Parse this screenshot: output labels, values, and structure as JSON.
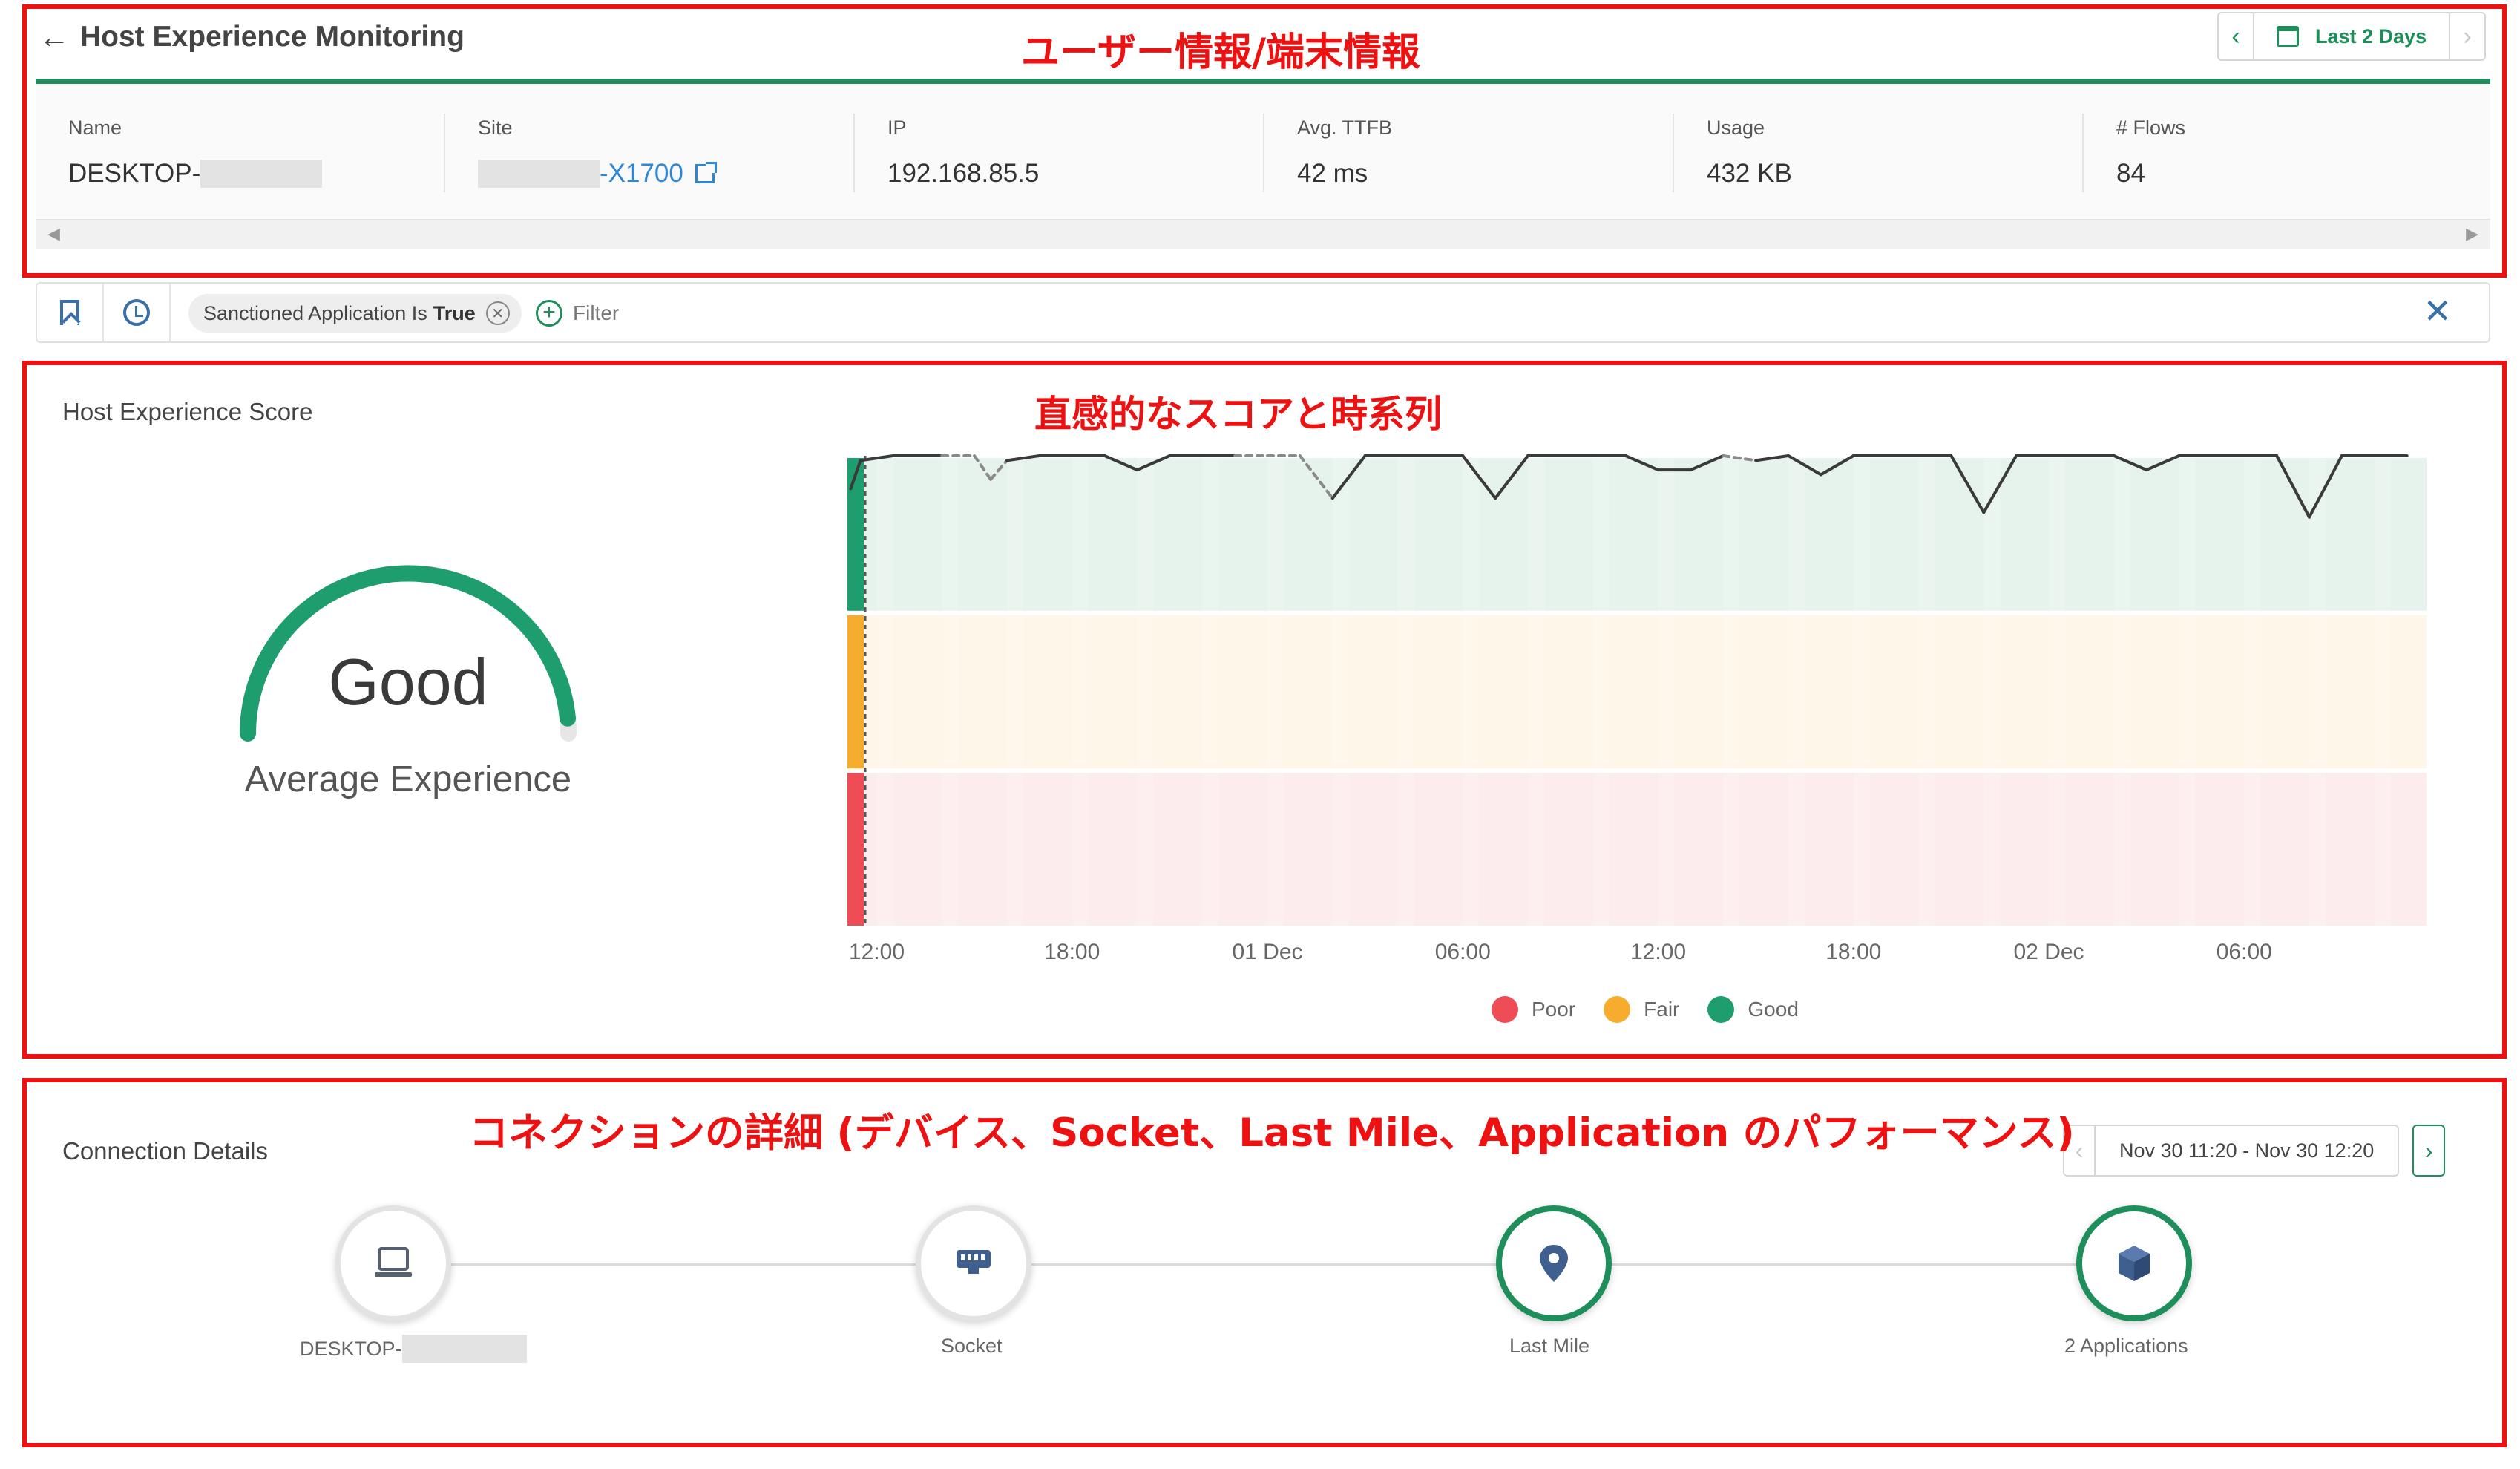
{
  "header": {
    "back_icon": "arrow-left-icon",
    "title": "Host Experience Monitoring",
    "time_range": {
      "prev_icon": "chevron-left-icon",
      "calendar_icon": "calendar-icon",
      "label": "Last 2 Days",
      "next_icon": "chevron-right-icon"
    }
  },
  "host_info": {
    "columns": [
      {
        "label": "Name",
        "value": "DESKTOP-",
        "redacted": true
      },
      {
        "label": "Site",
        "value": "-X1700",
        "redacted": true,
        "link": true,
        "icon": "external-link-icon"
      },
      {
        "label": "IP",
        "value": "192.168.85.5"
      },
      {
        "label": "Avg. TTFB",
        "value": "42 ms"
      },
      {
        "label": "Usage",
        "value": "432 KB"
      },
      {
        "label": "# Flows",
        "value": "84"
      }
    ]
  },
  "filter_bar": {
    "bookmark_icon": "bookmark-icon",
    "history_icon": "history-icon",
    "chip_prefix": "Sanctioned Application Is",
    "chip_value": "True",
    "chip_remove_icon": "close-circle-icon",
    "add_filter_label": "Filter",
    "clear_icon": "close-icon"
  },
  "score": {
    "title": "Host Experience Score",
    "gauge_value_label": "Good",
    "gauge_subtitle": "Average Experience",
    "gauge_fill": 0.97,
    "legend": [
      {
        "label": "Poor",
        "color": "#ee4d55"
      },
      {
        "label": "Fair",
        "color": "#f5ac2f"
      },
      {
        "label": "Good",
        "color": "#1e9e6e"
      }
    ]
  },
  "chart_data": {
    "type": "line",
    "title": "",
    "x_tick_labels": [
      "12:00",
      "18:00",
      "01 Dec",
      "06:00",
      "12:00",
      "18:00",
      "02 Dec",
      "06:00"
    ],
    "x_tick_hours": [
      0,
      6,
      12,
      18,
      24,
      30,
      36,
      42
    ],
    "x_range_hours": [
      -0.9,
      47.6
    ],
    "y_range": [
      0,
      100
    ],
    "bands": [
      {
        "name": "Good",
        "from": 66.7,
        "to": 100,
        "color": "#1e9e6e"
      },
      {
        "name": "Fair",
        "from": 33.3,
        "to": 66.7,
        "color": "#f5ac2f"
      },
      {
        "name": "Poor",
        "from": 0,
        "to": 33.3,
        "color": "#ee4d55"
      }
    ],
    "series": [
      {
        "points": [
          [
            -0.8,
            93
          ],
          [
            -0.5,
            99
          ],
          [
            0.5,
            100
          ],
          [
            2,
            100
          ],
          [
            3,
            100
          ],
          [
            3.5,
            95
          ],
          [
            4,
            99
          ],
          [
            5,
            100
          ],
          [
            6,
            100
          ],
          [
            7,
            100
          ],
          [
            8,
            97
          ],
          [
            9,
            100
          ],
          [
            10,
            100
          ],
          [
            11,
            100
          ],
          [
            12,
            100
          ],
          [
            13,
            100
          ],
          [
            14,
            91
          ],
          [
            15,
            100
          ],
          [
            16,
            100
          ],
          [
            17,
            100
          ],
          [
            18,
            100
          ],
          [
            19,
            91
          ],
          [
            20,
            100
          ],
          [
            21,
            100
          ],
          [
            22,
            100
          ],
          [
            23,
            100
          ],
          [
            24,
            97
          ],
          [
            25,
            97
          ],
          [
            26,
            100
          ],
          [
            27,
            99
          ],
          [
            28,
            100
          ],
          [
            29,
            96
          ],
          [
            30,
            100
          ],
          [
            31,
            100
          ],
          [
            32,
            100
          ],
          [
            33,
            100
          ],
          [
            34,
            88
          ],
          [
            35,
            100
          ],
          [
            36,
            100
          ],
          [
            37,
            100
          ],
          [
            38,
            100
          ],
          [
            39,
            97
          ],
          [
            40,
            100
          ],
          [
            41,
            100
          ],
          [
            42,
            100
          ],
          [
            43,
            100
          ],
          [
            44,
            87
          ],
          [
            45,
            100
          ],
          [
            46,
            100
          ],
          [
            47,
            100
          ]
        ],
        "dashed_segments": [
          [
            2,
            4
          ],
          [
            11,
            14
          ],
          [
            26,
            27
          ]
        ]
      }
    ]
  },
  "connection": {
    "title": "Connection Details",
    "range": {
      "prev_icon": "chevron-left-icon",
      "label": "Nov 30 11:20 - Nov 30 12:20",
      "next_icon": "chevron-right-icon"
    },
    "nodes": [
      {
        "label": "DESKTOP-",
        "redacted": true,
        "icon": "laptop-icon",
        "status": "grey"
      },
      {
        "label": "Socket",
        "icon": "socket-device-icon",
        "status": "grey"
      },
      {
        "label": "Last Mile",
        "icon": "location-pin-icon",
        "status": "good"
      },
      {
        "label": "2 Applications",
        "icon": "cube-icon",
        "status": "good"
      }
    ]
  },
  "annotations": {
    "header_note": "ユーザー情報/端末情報",
    "score_note": "直感的なスコアと時系列",
    "connection_note": "コネクションの詳細 (デバイス、Socket、Last Mile、Application のパフォーマンス)"
  },
  "colors": {
    "accent": "#1e8f5a",
    "annotation": "#ee1111",
    "link": "#2f86d6"
  }
}
